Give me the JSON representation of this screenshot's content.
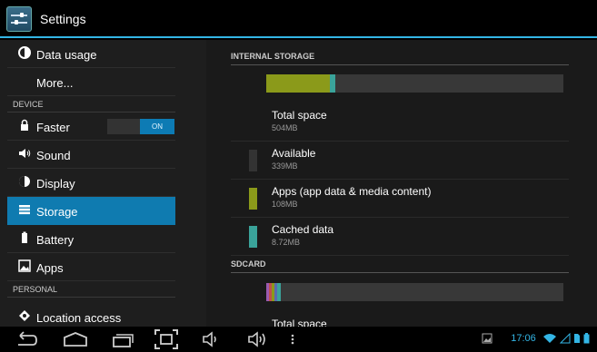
{
  "app": {
    "title": "Settings"
  },
  "left": {
    "items": [
      {
        "label": "Data usage",
        "icon": "data-usage-icon"
      },
      {
        "label": "More...",
        "icon": ""
      },
      {
        "header": "DEVICE"
      },
      {
        "label": "Faster",
        "icon": "lock-icon",
        "toggle": "ON"
      },
      {
        "label": "Sound",
        "icon": "sound-icon"
      },
      {
        "label": "Display",
        "icon": "display-icon"
      },
      {
        "label": "Storage",
        "icon": "storage-icon",
        "selected": true
      },
      {
        "label": "Battery",
        "icon": "battery-icon"
      },
      {
        "label": "Apps",
        "icon": "apps-icon"
      },
      {
        "header": "PERSONAL"
      },
      {
        "label": "Location access",
        "icon": "location-icon"
      }
    ]
  },
  "right": {
    "internal_header": "INTERNAL STORAGE",
    "internal_bar": {
      "apps_fraction": 0.214,
      "cached_fraction": 0.017
    },
    "rows": [
      {
        "title": "Total space",
        "value": "504MB",
        "swatch": ""
      },
      {
        "title": "Available",
        "value": "339MB",
        "swatch": "#333333"
      },
      {
        "title": "Apps (app data & media content)",
        "value": "108MB",
        "swatch": "#8b9a1a"
      },
      {
        "title": "Cached data",
        "value": "8.72MB",
        "swatch": "#3aa39a"
      }
    ],
    "sdcard_header": "SDCARD",
    "sdcard_total": "Total space"
  },
  "status": {
    "time": "17:06"
  },
  "colors": {
    "accent": "#33b5e5",
    "selected": "#0f7bb0",
    "apps": "#8b9a1a",
    "cached": "#3aa39a"
  }
}
